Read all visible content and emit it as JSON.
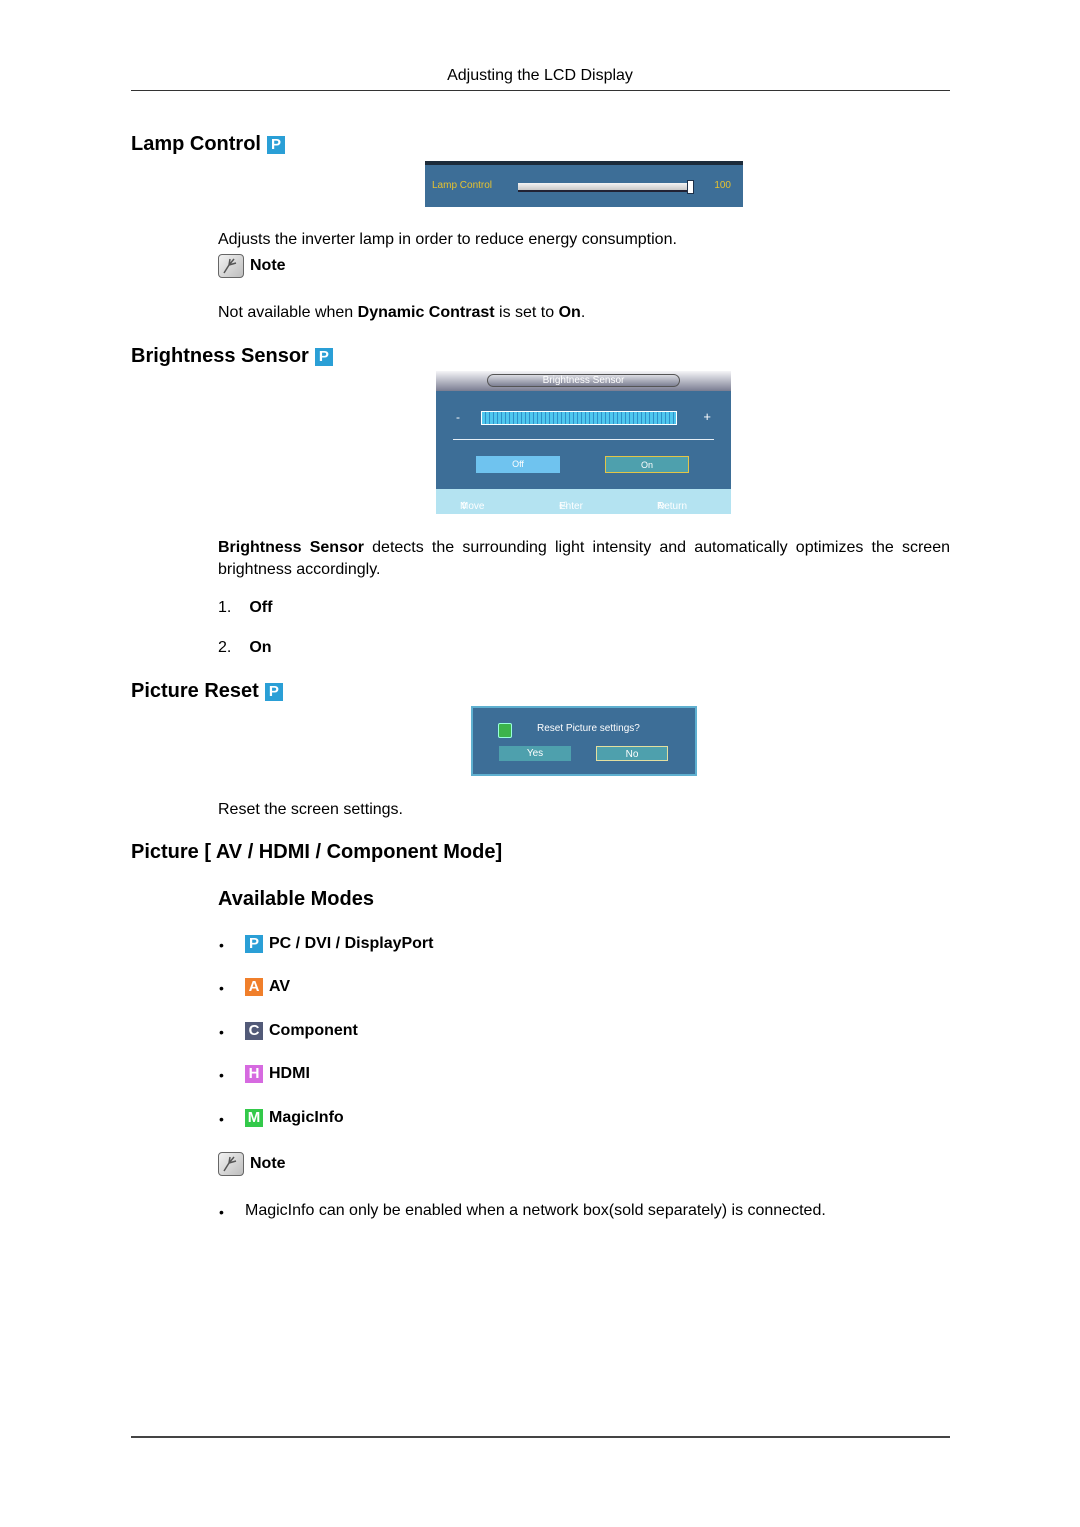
{
  "header": {
    "title": "Adjusting the LCD Display"
  },
  "sections": {
    "lamp_control": {
      "title": "Lamp Control",
      "mode_icon": "P",
      "osd": {
        "label": "Lamp Control",
        "value": "100",
        "slider_percent": 100
      },
      "description": "Adjusts the inverter lamp in order to reduce energy consumption.",
      "note_label": "Note",
      "note": {
        "prefix": "Not available when ",
        "bold1": "Dynamic Contrast",
        "middle": " is set to ",
        "bold2": "On",
        "suffix": "."
      }
    },
    "brightness_sensor": {
      "title": "Brightness Sensor",
      "mode_icon": "P",
      "osd": {
        "title": "Brightness Sensor",
        "minus": "-",
        "plus": "+",
        "options": [
          "Off",
          "On"
        ],
        "selected": "On",
        "footer": {
          "move": "Move",
          "enter": "Enter",
          "return": "Return"
        }
      },
      "description_bold": "Brightness Sensor",
      "description": " detects the surrounding light intensity and automatically optimizes the screen brightness accordingly.",
      "list": [
        {
          "num": "1.",
          "label": "Off"
        },
        {
          "num": "2.",
          "label": "On"
        }
      ]
    },
    "picture_reset": {
      "title": "Picture Reset",
      "mode_icon": "P",
      "osd": {
        "question": "Reset Picture settings?",
        "yes": "Yes",
        "no": "No",
        "selected": "No"
      },
      "description": "Reset the screen settings."
    },
    "picture_av": {
      "title": "Picture [ AV / HDMI / Component Mode]",
      "subtitle": "Available Modes",
      "modes": [
        {
          "icon": "P",
          "color": "#2a9fd6",
          "label": "PC / DVI / DisplayPort"
        },
        {
          "icon": "A",
          "color": "#f07f2b",
          "label": "AV"
        },
        {
          "icon": "C",
          "color": "#525a78",
          "label": "Component"
        },
        {
          "icon": "H",
          "color": "#d66ae0",
          "label": "HDMI"
        },
        {
          "icon": "M",
          "color": "#33c94a",
          "label": "MagicInfo"
        }
      ],
      "note_label": "Note",
      "note": "MagicInfo can only be enabled when a network box(sold separately) is connected."
    }
  }
}
